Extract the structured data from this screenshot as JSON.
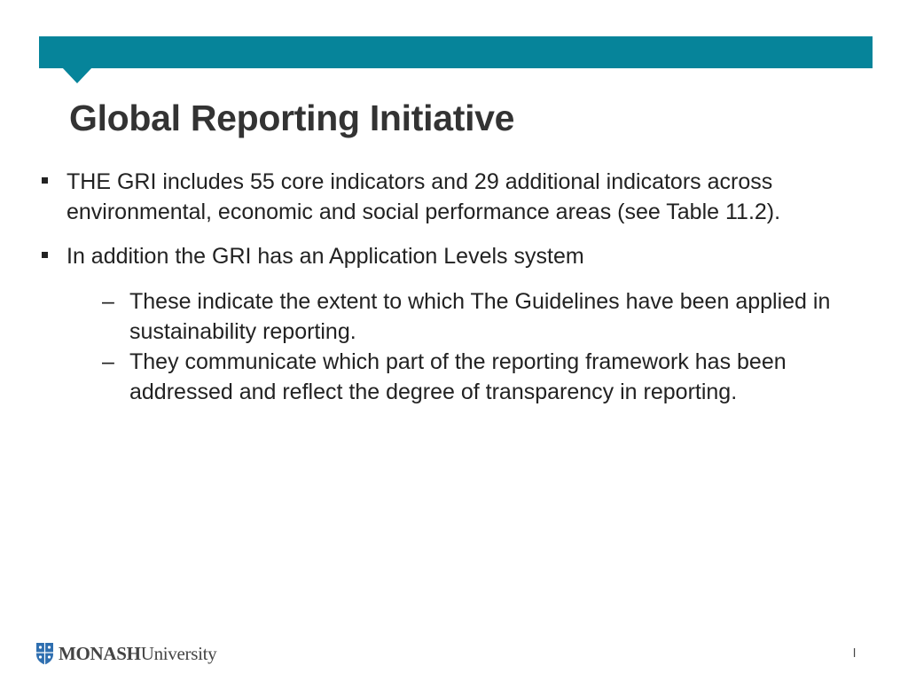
{
  "slide": {
    "title": "Global Reporting Initiative",
    "bullets": [
      {
        "text": "THE GRI includes 55 core indicators and 29 additional indicators across environmental, economic and social performance areas (see Table 11.2)."
      },
      {
        "text": "In addition the GRI has an Application Levels system",
        "sub_bullets": [
          "These indicate the extent to which The Guidelines have been applied in sustainability reporting.",
          "They communicate which part of the reporting framework has been addressed and reflect the degree of transparency in reporting."
        ]
      }
    ]
  },
  "footer": {
    "logo_bold": "MONASH",
    "logo_regular": "University",
    "logo_icon": "shield-icon",
    "page_number": "l"
  },
  "colors": {
    "accent": "#06849a",
    "text": "#222222"
  }
}
